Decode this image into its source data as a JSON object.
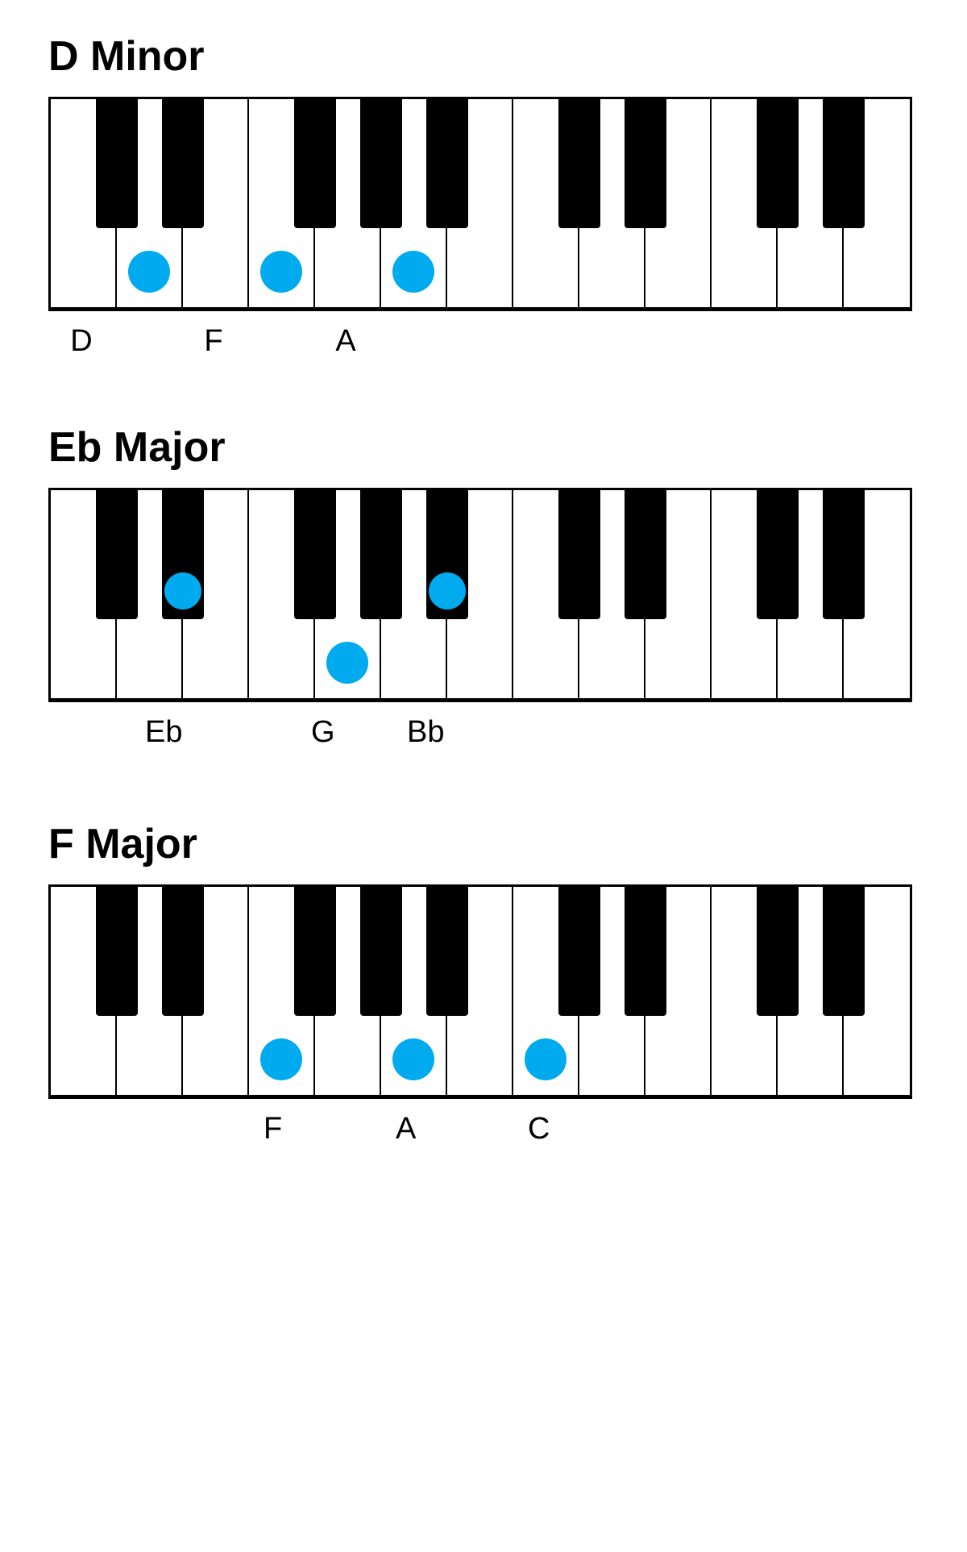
{
  "chords": [
    {
      "id": "d-minor",
      "title": "D Minor",
      "notes": [
        "D",
        "F",
        "A"
      ],
      "noteLabels": [
        {
          "label": "D",
          "offsetX": 41
        },
        {
          "label": "F",
          "offsetX": 207
        },
        {
          "label": "A",
          "offsetX": 372
        }
      ]
    },
    {
      "id": "eb-major",
      "title": "Eb Major",
      "notes": [
        "Eb",
        "G",
        "Bb"
      ],
      "noteLabels": [
        {
          "label": "Eb",
          "offsetX": 15
        },
        {
          "label": "G",
          "offsetX": 290
        },
        {
          "label": "Bb",
          "offsetX": 370
        }
      ]
    },
    {
      "id": "f-major",
      "title": "F Major",
      "notes": [
        "F",
        "A",
        "C"
      ],
      "noteLabels": [
        {
          "label": "F",
          "offsetX": 123
        },
        {
          "label": "A",
          "offsetX": 289
        },
        {
          "label": "C",
          "offsetX": 455
        }
      ]
    }
  ]
}
